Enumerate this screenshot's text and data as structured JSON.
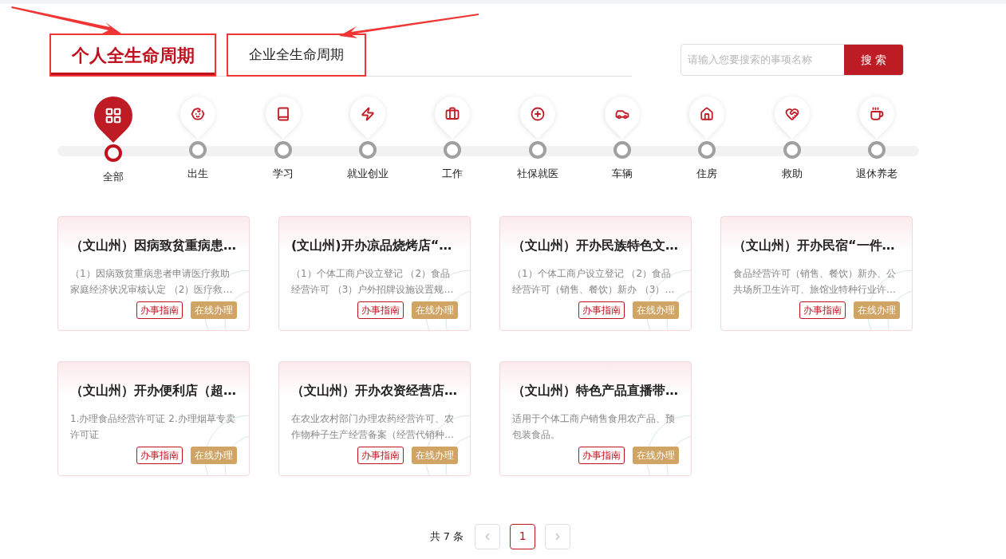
{
  "tabs": [
    {
      "label": "个人全生命周期",
      "selected": true
    },
    {
      "label": "企业全生命周期",
      "selected": false
    }
  ],
  "search": {
    "placeholder": "请输入您要搜索的事项名称",
    "button": "搜 索"
  },
  "categories": [
    {
      "label": "全部",
      "kind": "all",
      "selected": true
    },
    {
      "label": "出生",
      "kind": "birth",
      "selected": false
    },
    {
      "label": "学习",
      "kind": "study",
      "selected": false
    },
    {
      "label": "就业创业",
      "kind": "career",
      "selected": false
    },
    {
      "label": "工作",
      "kind": "work",
      "selected": false
    },
    {
      "label": "社保就医",
      "kind": "medical",
      "selected": false
    },
    {
      "label": "车辆",
      "kind": "car",
      "selected": false
    },
    {
      "label": "住房",
      "kind": "house",
      "selected": false
    },
    {
      "label": "救助",
      "kind": "aid",
      "selected": false
    },
    {
      "label": "退休养老",
      "kind": "retire",
      "selected": false
    }
  ],
  "cards": [
    {
      "title": "（文山州）因病致贫重病患…",
      "description": "（1）因病致贫重病患者申请医疗救助家庭经济状况审核认定 （2）医疗救…",
      "guide": "办事指南",
      "online": "在线办理"
    },
    {
      "title": "(文山州)开办凉品烧烤店“…",
      "description": "（1）个体工商户设立登记 （2）食品经营许可 （3）户外招牌设施设置规…",
      "guide": "办事指南",
      "online": "在线办理"
    },
    {
      "title": "（文山州）开办民族特色文…",
      "description": "（1）个体工商户设立登记 （2）食品经营许可（销售、餐饮）新办 （3）…",
      "guide": "办事指南",
      "online": "在线办理"
    },
    {
      "title": "（文山州）开办民宿“一件…",
      "description": "食品经营许可（销售、餐饮）新办、公共场所卫生许可、旅馆业特种行业许…",
      "guide": "办事指南",
      "online": "在线办理"
    },
    {
      "title": "（文山州）开办便利店（超…",
      "description": "1.办理食品经营许可证 2.办理烟草专卖许可证",
      "guide": "办事指南",
      "online": "在线办理"
    },
    {
      "title": "（文山州）开办农资经营店…",
      "description": "在农业农村部门办理农药经营许可、农作物种子生产经营备案（经营代销种…",
      "guide": "办事指南",
      "online": "在线办理"
    },
    {
      "title": "（文山州）特色产品直播带…",
      "description": "适用于个体工商户销售食用农产品、预包装食品。",
      "guide": "办事指南",
      "online": "在线办理"
    }
  ],
  "pagination": {
    "total": "共 7 条",
    "pages": [
      {
        "label": "1",
        "selected": true
      }
    ]
  }
}
